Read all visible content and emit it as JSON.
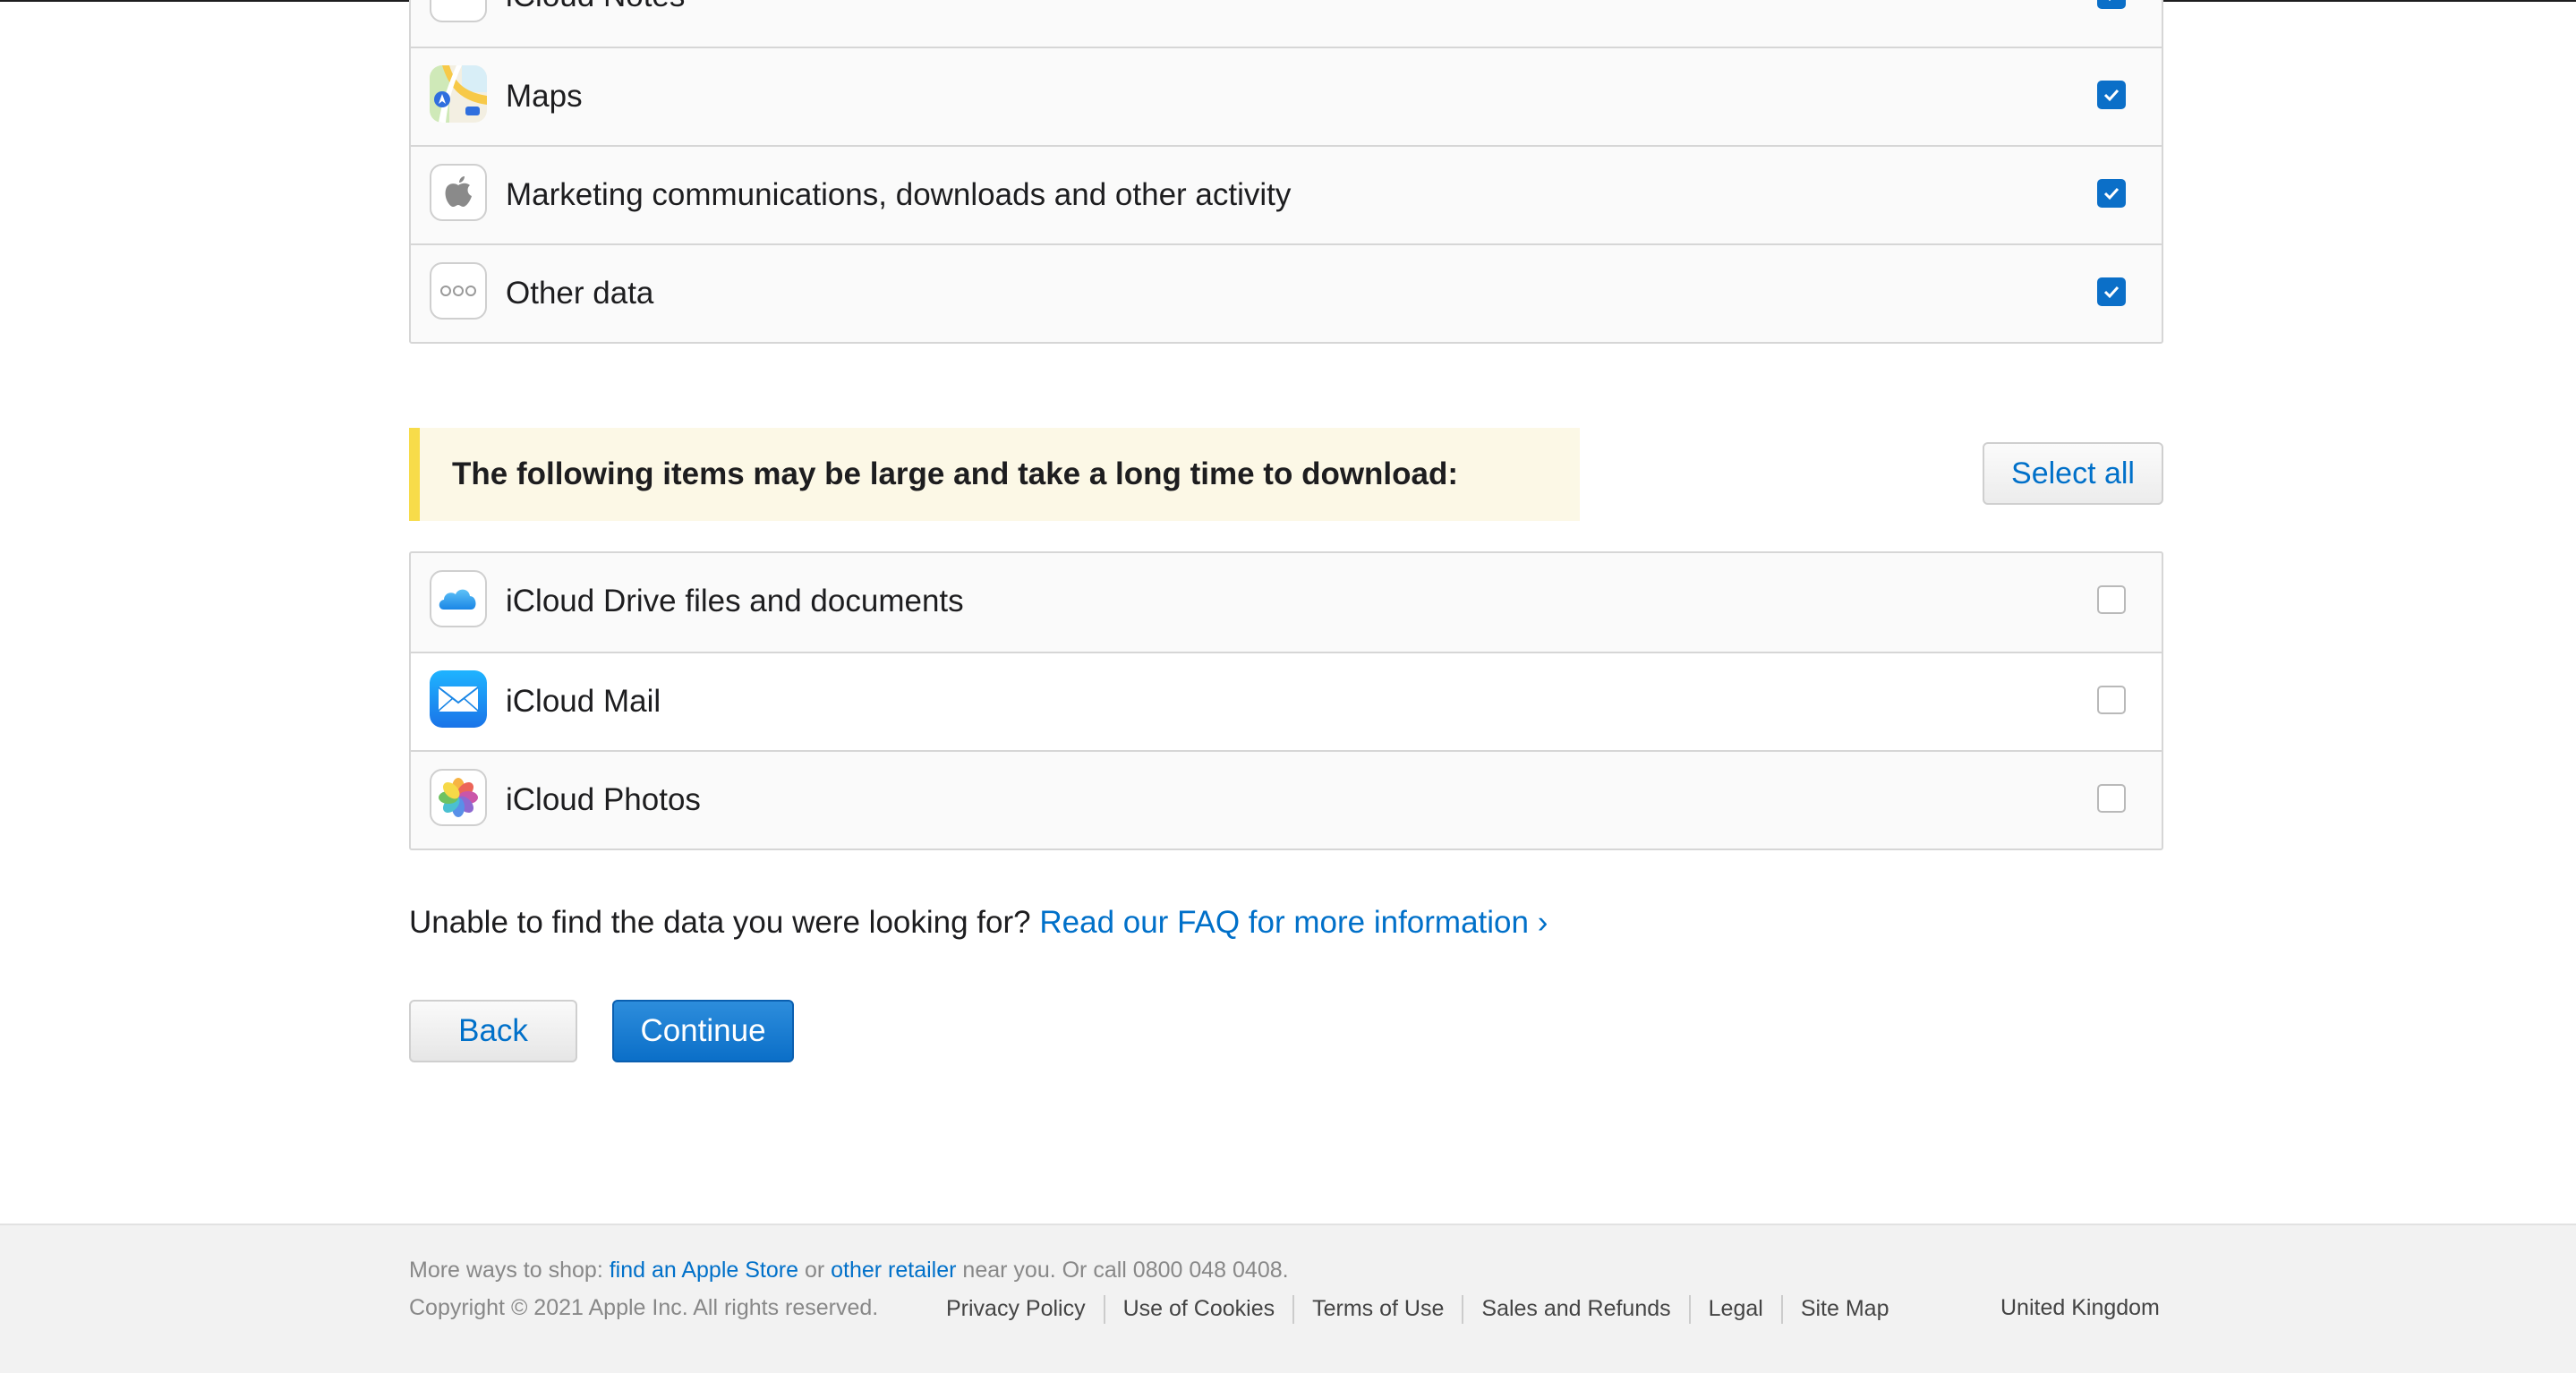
{
  "data_items": [
    {
      "label": "iCloud Notes",
      "icon": "notes-icon",
      "checked": true
    },
    {
      "label": "Maps",
      "icon": "maps-icon",
      "checked": true
    },
    {
      "label": "Marketing communications, downloads and other activity",
      "icon": "apple-logo-icon",
      "checked": true
    },
    {
      "label": "Other data",
      "icon": "ellipsis-icon",
      "checked": true
    }
  ],
  "large_items": {
    "notice": "The following items may be large and take a long time to download:",
    "select_all_label": "Select all",
    "items": [
      {
        "label": "iCloud Drive files and documents",
        "icon": "icloud-drive-icon",
        "checked": false
      },
      {
        "label": "iCloud Mail",
        "icon": "mail-icon",
        "checked": false
      },
      {
        "label": "iCloud Photos",
        "icon": "photos-icon",
        "checked": false
      }
    ]
  },
  "faq": {
    "prompt": "Unable to find the data you were looking for?",
    "link": "Read our FAQ for more information ›"
  },
  "actions": {
    "back_label": "Back",
    "continue_label": "Continue"
  },
  "footer": {
    "shop_prefix": "More ways to shop: ",
    "store_link": "find an Apple Store",
    "or": " or ",
    "retailer_link": "other retailer",
    "shop_suffix": " near you. Or call 0800 048 0408.",
    "copyright": "Copyright © 2021 Apple Inc. All rights reserved.",
    "links": [
      "Privacy Policy",
      "Use of Cookies",
      "Terms of Use",
      "Sales and Refunds",
      "Legal",
      "Site Map"
    ],
    "country": "United Kingdom"
  },
  "colors": {
    "accent": "#0070c9",
    "checkbox_on": "#0b6fc8",
    "notice_bg": "#fcf8e6",
    "notice_bar": "#f7dc4a"
  }
}
